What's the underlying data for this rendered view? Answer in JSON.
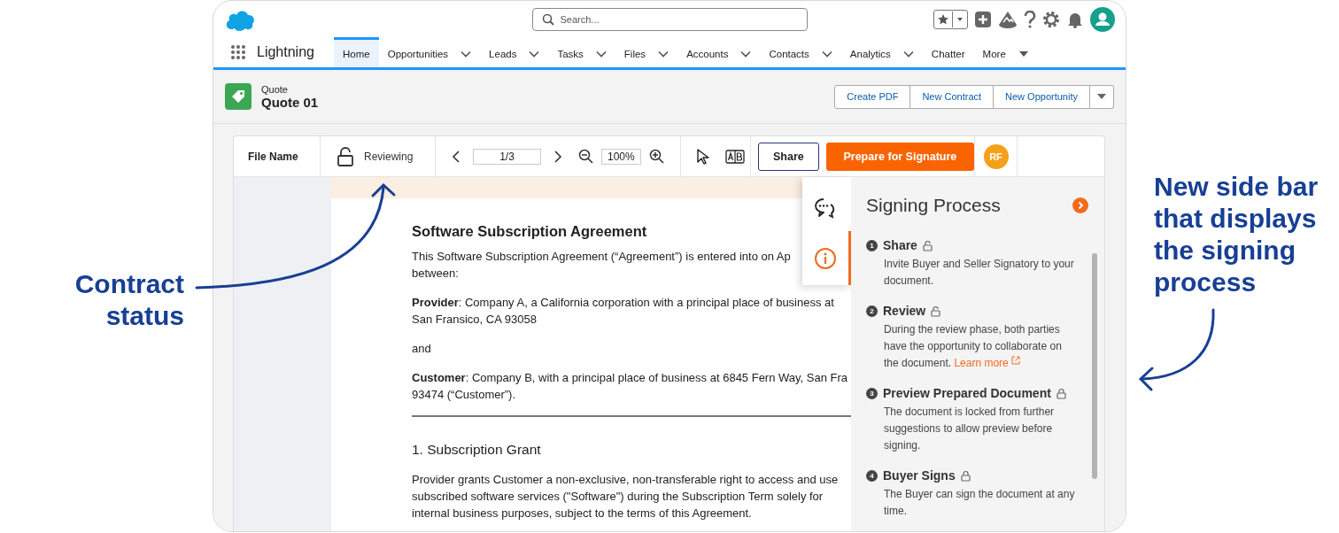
{
  "annotations": {
    "left": "Contract status",
    "right": "New side bar that displays the signing process"
  },
  "app": {
    "name": "Lightning"
  },
  "search": {
    "placeholder": "Search..."
  },
  "nav": [
    {
      "label": "Home",
      "selected": true,
      "kind": "link"
    },
    {
      "label": "Opportunities",
      "selected": false,
      "kind": "dropdown"
    },
    {
      "label": "Leads",
      "selected": false,
      "kind": "dropdown"
    },
    {
      "label": "Tasks",
      "selected": false,
      "kind": "dropdown"
    },
    {
      "label": "Files",
      "selected": false,
      "kind": "dropdown"
    },
    {
      "label": "Accounts",
      "selected": false,
      "kind": "dropdown"
    },
    {
      "label": "Contacts",
      "selected": false,
      "kind": "dropdown"
    },
    {
      "label": "Analytics",
      "selected": false,
      "kind": "dropdown"
    },
    {
      "label": "Chatter",
      "selected": false,
      "kind": "link"
    },
    {
      "label": "More",
      "selected": false,
      "kind": "overflow"
    }
  ],
  "record": {
    "type": "Quote",
    "name": "Quote 01",
    "actions": [
      "Create PDF",
      "New Contract",
      "New Opportunity"
    ]
  },
  "toolbar": {
    "file_name": "File Name",
    "status": {
      "label": "Reviewing",
      "locked": false
    },
    "page": "1/3",
    "zoom": "100%",
    "share": "Share",
    "prepare": "Prepare for Signature",
    "avatar": "RF"
  },
  "document": {
    "title": "Software Subscription Agreement",
    "blocks": [
      {
        "kind": "para",
        "lines": [
          "This Software Subscription Agreement (“Agreement”) is entered into on Ap",
          "between:"
        ]
      },
      {
        "kind": "para",
        "lines": [
          "**Provider**: Company A, a California corporation with a principal place of business at",
          "San Fransico, CA 93058"
        ]
      },
      {
        "kind": "para",
        "lines": [
          "and"
        ]
      },
      {
        "kind": "para",
        "lines": [
          "**Customer**: Company B, with a principal place of business at 6845 Fern Way, San Fra",
          "93474 (“Customer”)."
        ]
      },
      {
        "kind": "rule"
      },
      {
        "kind": "heading",
        "lines": [
          "1. Subscription Grant"
        ]
      },
      {
        "kind": "para",
        "lines": [
          "Provider grants Customer a non-exclusive, non-transferable right to access and use",
          "subscribed software services (\"Software\") during the Subscription Term solely for",
          "internal business purposes, subject to the terms of this Agreement."
        ]
      }
    ]
  },
  "side_tabs": [
    {
      "kind": "comments",
      "selected": false
    },
    {
      "kind": "info",
      "selected": true
    }
  ],
  "signing": {
    "title": "Signing Process",
    "steps": [
      {
        "number": "1",
        "title": "Share",
        "locked": false,
        "description": "Invite Buyer and Seller Signatory to your document."
      },
      {
        "number": "2",
        "title": "Review",
        "locked": false,
        "description": "During the review phase, both parties have the opportunity to collaborate on the document.",
        "link": "Learn more"
      },
      {
        "number": "3",
        "title": "Preview Prepared Document",
        "locked": true,
        "description": "The document is locked from further suggestions to allow preview before signing."
      },
      {
        "number": "4",
        "title": "Buyer Signs",
        "locked": true,
        "description": "The Buyer can sign the document at any time."
      }
    ]
  }
}
